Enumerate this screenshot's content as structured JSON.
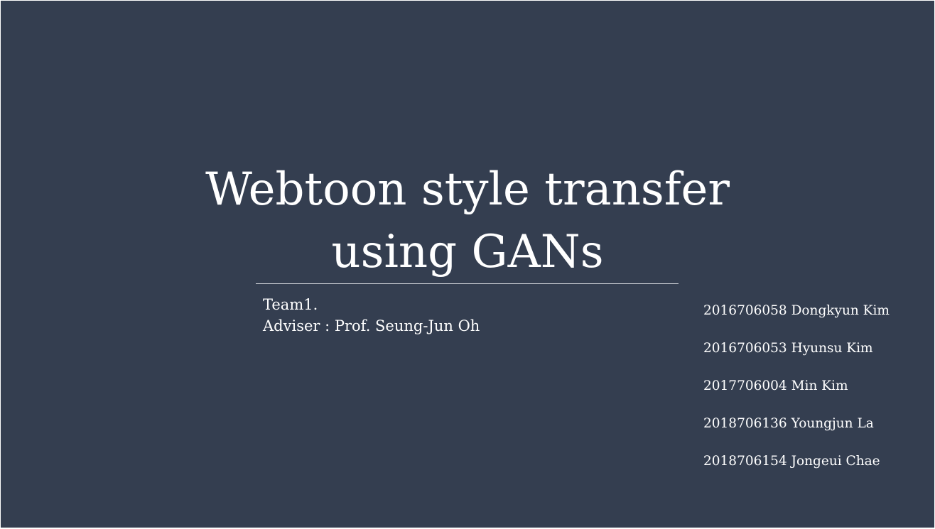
{
  "slide": {
    "title_lines": [
      "Webtoon style transfer",
      "using GANs"
    ],
    "team": "Team1.",
    "adviser": "Adviser : Prof.  Seung-Jun Oh",
    "members": [
      "2016706058 Dongkyun Kim",
      "2016706053 Hyunsu Kim",
      "2017706004 Min Kim",
      "2018706136 Youngjun La",
      "2018706154 Jongeui Chae"
    ],
    "colors": {
      "background": "#343e50",
      "text": "#ffffff",
      "divider": "#c9ccd2"
    }
  }
}
